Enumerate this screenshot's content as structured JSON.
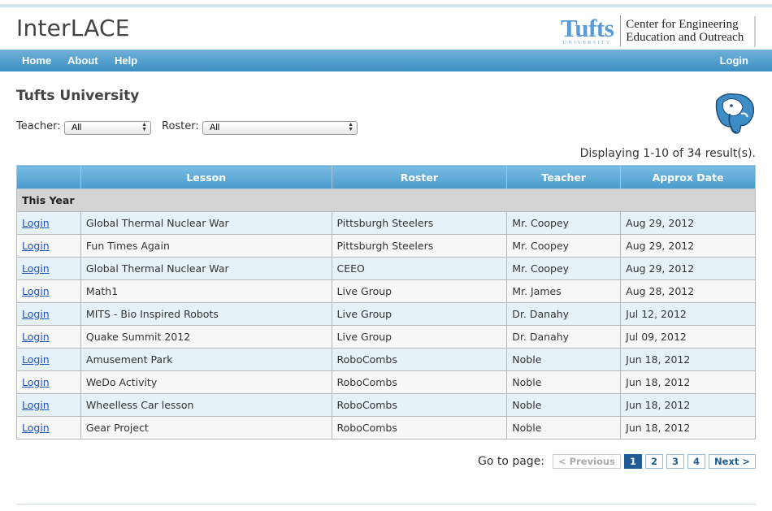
{
  "app": {
    "title": "InterLACE"
  },
  "brand": {
    "logo_word": "Tufts",
    "logo_sub": "UNIVERSITY",
    "ceeo_line1": "Center for Engineering",
    "ceeo_line2": "Education and Outreach"
  },
  "nav": {
    "items": [
      {
        "label": "Home"
      },
      {
        "label": "About"
      },
      {
        "label": "Help"
      }
    ],
    "login_label": "Login",
    "bar_color": "#4a9acb"
  },
  "page": {
    "heading": "Tufts University"
  },
  "filters": {
    "teacher_label": "Teacher:",
    "teacher_value": "All",
    "roster_label": "Roster:",
    "roster_value": "All"
  },
  "results": {
    "summary": "Displaying 1-10 of 34 result(s)."
  },
  "table": {
    "columns": [
      "",
      "Lesson",
      "Roster",
      "Teacher",
      "Approx Date"
    ],
    "group_label": "This Year",
    "rows": [
      {
        "action": "Login",
        "lesson": "Global Thermal Nuclear War",
        "roster": "Pittsburgh Steelers",
        "teacher": "Mr. Coopey",
        "date": "Aug 29, 2012"
      },
      {
        "action": "Login",
        "lesson": "Fun Times Again",
        "roster": "Pittsburgh Steelers",
        "teacher": "Mr. Coopey",
        "date": "Aug 29, 2012"
      },
      {
        "action": "Login",
        "lesson": "Global Thermal Nuclear War",
        "roster": "CEEO",
        "teacher": "Mr. Coopey",
        "date": "Aug 29, 2012"
      },
      {
        "action": "Login",
        "lesson": "Math1",
        "roster": "Live Group",
        "teacher": "Mr. James",
        "date": "Aug 28, 2012"
      },
      {
        "action": "Login",
        "lesson": "MITS - Bio Inspired Robots",
        "roster": "Live Group",
        "teacher": "Dr. Danahy",
        "date": "Jul 12, 2012"
      },
      {
        "action": "Login",
        "lesson": "Quake Summit 2012",
        "roster": "Live Group",
        "teacher": "Dr. Danahy",
        "date": "Jul 09, 2012"
      },
      {
        "action": "Login",
        "lesson": "Amusement Park",
        "roster": "RoboCombs",
        "teacher": "Noble",
        "date": "Jun 18, 2012"
      },
      {
        "action": "Login",
        "lesson": "WeDo Activity",
        "roster": "RoboCombs",
        "teacher": "Noble",
        "date": "Jun 18, 2012"
      },
      {
        "action": "Login",
        "lesson": "Wheelless Car lesson",
        "roster": "RoboCombs",
        "teacher": "Noble",
        "date": "Jun 18, 2012"
      },
      {
        "action": "Login",
        "lesson": "Gear Project",
        "roster": "RoboCombs",
        "teacher": "Noble",
        "date": "Jun 18, 2012"
      }
    ]
  },
  "pager": {
    "label": "Go to page:",
    "previous": "< Previous",
    "pages": [
      "1",
      "2",
      "3",
      "4"
    ],
    "current": "1",
    "next": "Next >"
  }
}
